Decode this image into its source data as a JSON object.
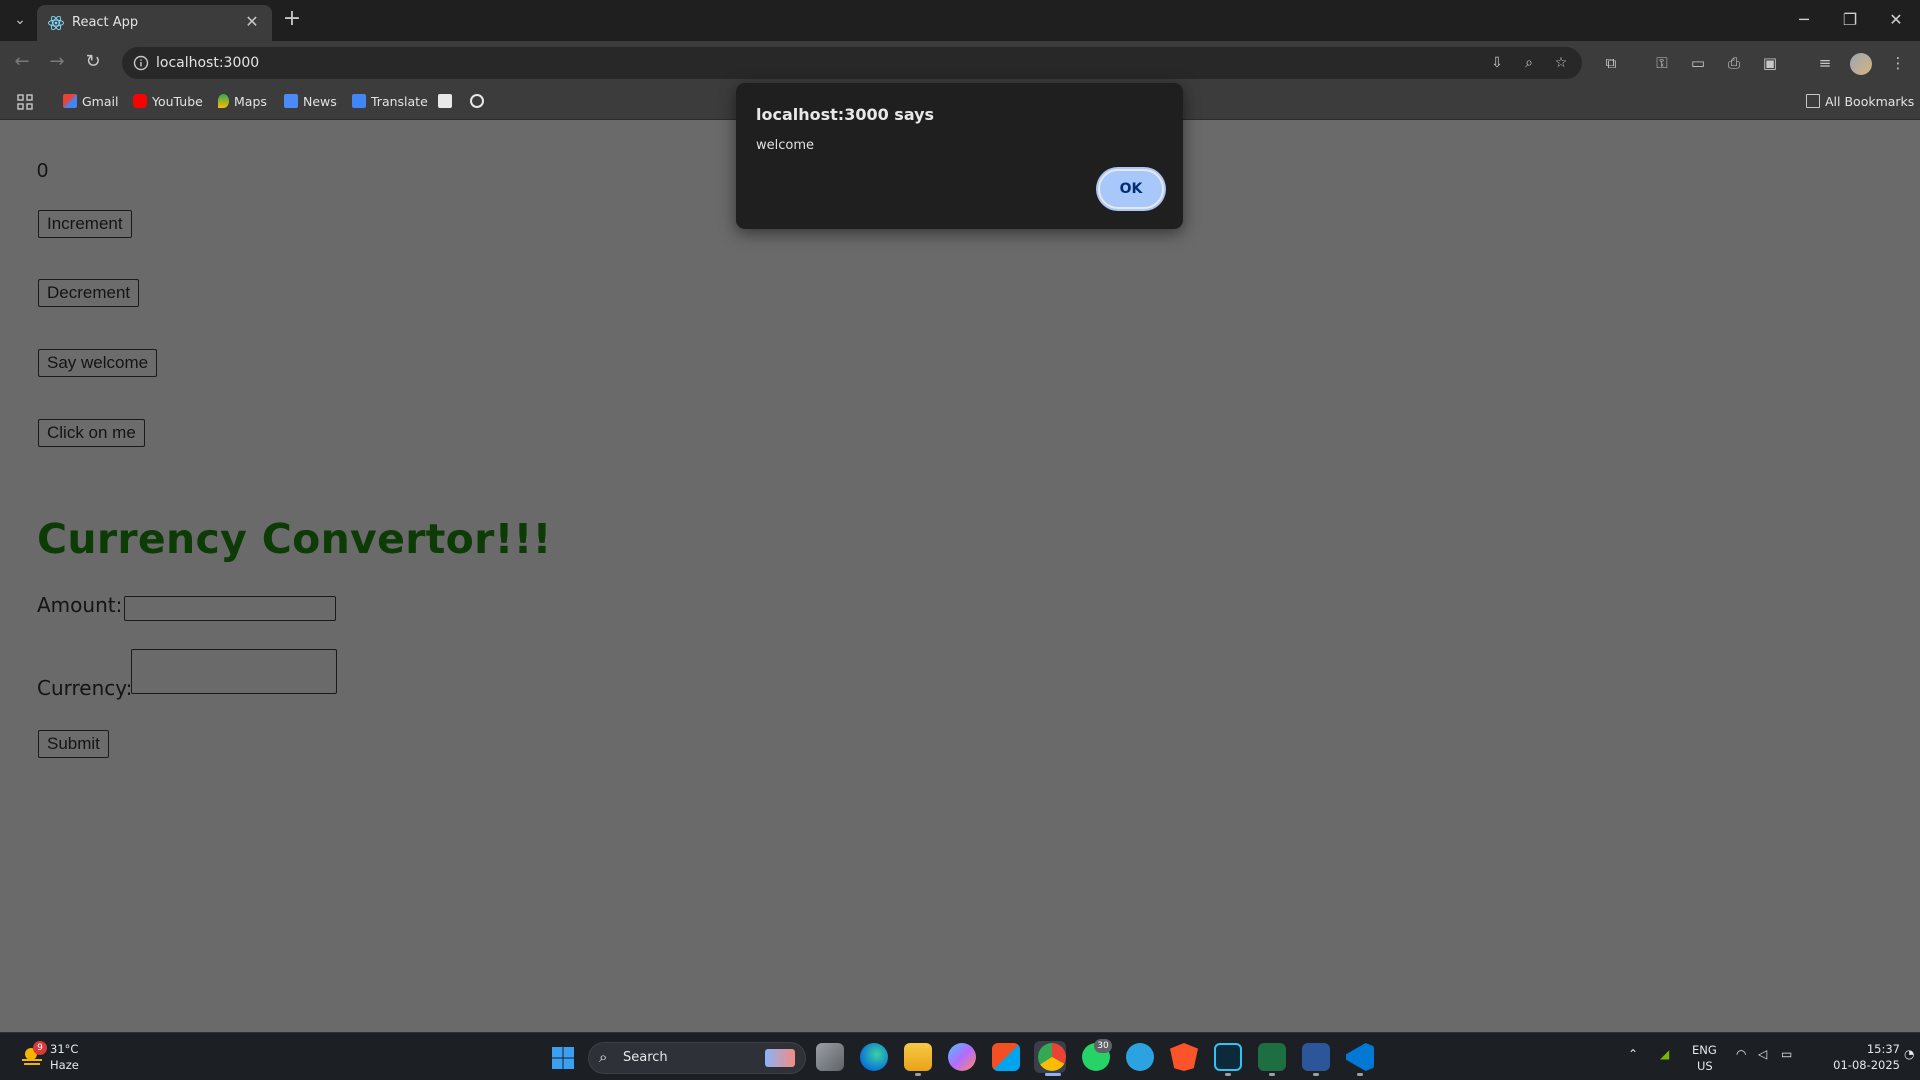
{
  "browser": {
    "tab_title": "React App",
    "url": "localhost:3000",
    "bookmarks": [
      "Gmail",
      "YouTube",
      "Maps",
      "News",
      "Translate"
    ],
    "all_bookmarks_label": "All Bookmarks",
    "accent_color": "#a8c7fa"
  },
  "page": {
    "count": "0",
    "buttons": {
      "increment": "Increment",
      "decrement": "Decrement",
      "say_welcome": "Say welcome",
      "click_on_me": "Click on me"
    },
    "heading": "Currency Convertor!!!",
    "heading_color": "#0f4a08",
    "amount_label": "Amount:",
    "amount_value": "",
    "currency_label": "Currency:",
    "currency_value": "",
    "submit_label": "Submit"
  },
  "dialog": {
    "title": "localhost:3000 says",
    "message": "welcome",
    "ok_label": "OK"
  },
  "taskbar": {
    "weather_temp": "31°C",
    "weather_condition": "Haze",
    "weather_badge": "9",
    "search_label": "Search",
    "whatsapp_badge": "30",
    "lang_line1": "ENG",
    "lang_line2": "US",
    "time": "15:37",
    "date": "01-08-2025"
  }
}
